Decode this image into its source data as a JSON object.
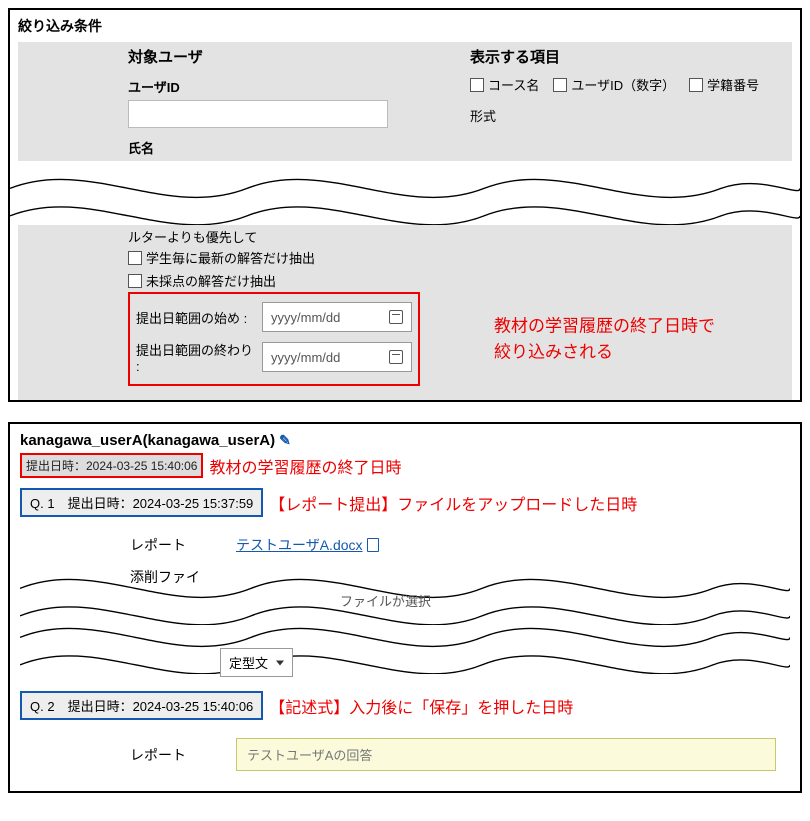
{
  "panel1": {
    "title": "絞り込み条件",
    "target_user_label": "対象ユーザ",
    "user_id_label": "ユーザID",
    "name_label": "氏名",
    "filter_priority_fragment": "ルターよりも優先して",
    "chk_latest": "学生毎に最新の解答だけ抽出",
    "chk_ungraded": "未採点の解答だけ抽出",
    "date_start_label": "提出日範囲の始め :",
    "date_end_label": "提出日範囲の終わり :",
    "date_placeholder": "yyyy/mm/dd",
    "display_cols_label": "表示する項目",
    "col_course": "コース名",
    "col_userid": "ユーザID（数字）",
    "col_stuno": "学籍番号",
    "format_fragment": "形式",
    "annot_lines": [
      "教材の学習履歴の終了日時で",
      "絞り込みされる"
    ]
  },
  "panel2": {
    "user_display": "kanagawa_userA(kanagawa_userA)",
    "submit_ts_head": "提出日時：2024-03-25 15:40:06",
    "annot_end_time": "教材の学習履歴の終了日時",
    "q1_label": "Q. 1　提出日時：2024-03-25 15:37:59",
    "annot_q1": "【レポート提出】ファイルをアップロードした日時",
    "report_label": "レポート",
    "file_link": "テストユーザA.docx",
    "correction_file_label": "添削ファイ",
    "file_selected_fragment": "ファイルが選択",
    "template_label": "定型文",
    "q2_label": "Q. 2　提出日時：2024-03-25 15:40:06",
    "annot_q2": "【記述式】入力後に「保存」を押した日時",
    "answer_placeholder": "テストユーザAの回答"
  }
}
